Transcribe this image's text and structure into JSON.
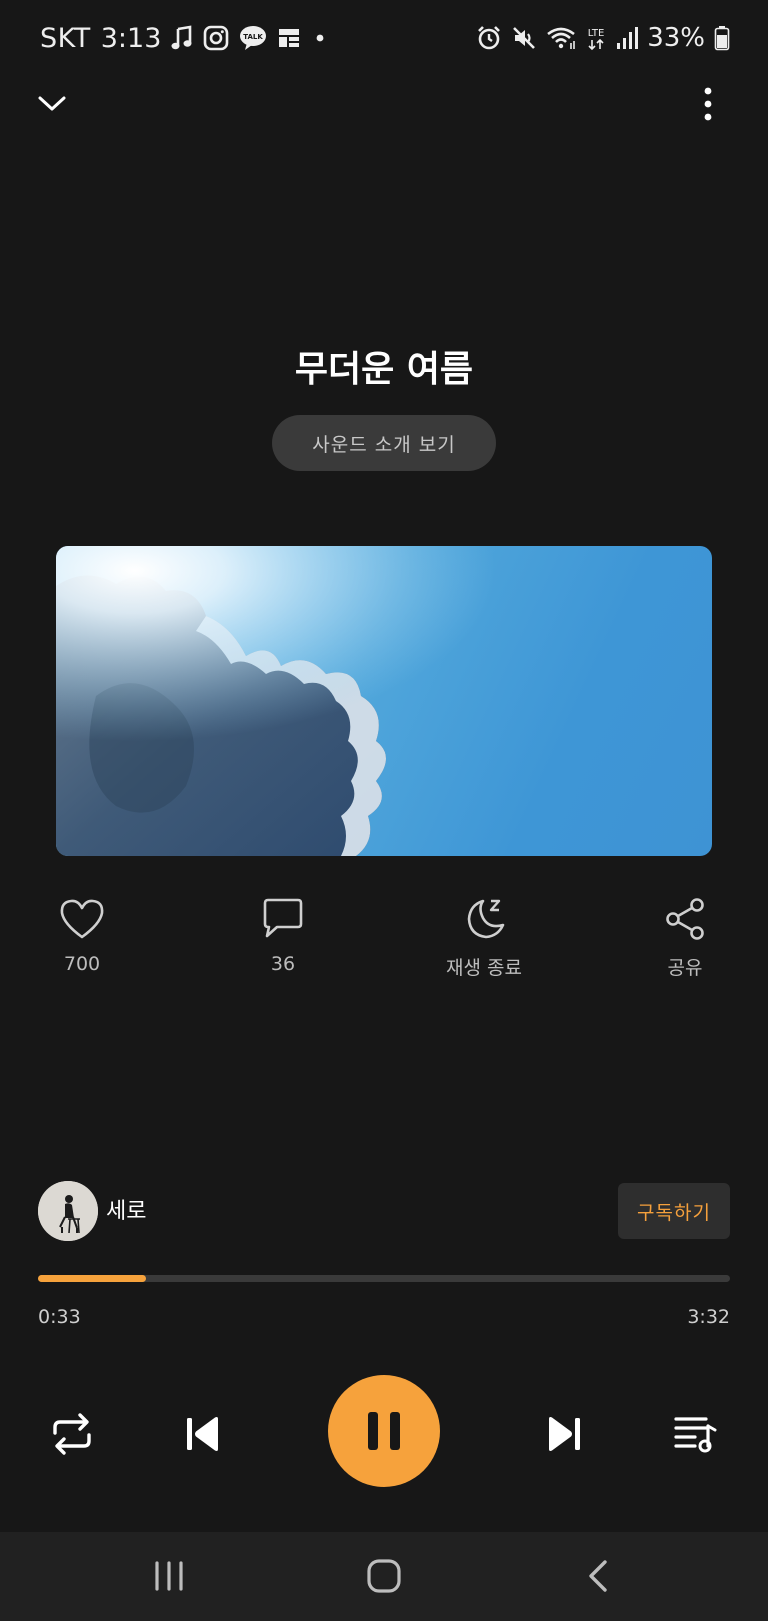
{
  "status_bar": {
    "carrier": "SKT",
    "time": "3:13",
    "battery": "33%",
    "network": "LTE",
    "icons_left": [
      "music-note-icon",
      "instagram-icon",
      "kakaotalk-icon",
      "news-icon",
      "dot-icon"
    ],
    "icons_right": [
      "alarm-icon",
      "mute-icon",
      "wifi-icon",
      "lte-icon",
      "signal-icon",
      "battery-icon"
    ]
  },
  "header": {
    "collapse_icon": "chevron-down-icon",
    "more_icon": "more-vertical-icon"
  },
  "track": {
    "title": "무더운 여름",
    "intro_button": "사운드 소개 보기",
    "cover_description": "sunlit clouds in blue sky"
  },
  "actions": {
    "like": {
      "icon": "heart-icon",
      "label": "700"
    },
    "comment": {
      "icon": "comment-icon",
      "label": "36"
    },
    "sleep_timer": {
      "icon": "moon-sleep-icon",
      "label": "재생 종료"
    },
    "share": {
      "icon": "share-icon",
      "label": "공유"
    }
  },
  "artist": {
    "name": "세로",
    "subscribe_label": "구독하기"
  },
  "playback": {
    "current_time": "0:33",
    "total_time": "3:32",
    "progress": 0.156
  },
  "controls": [
    "repeat-icon",
    "previous-icon",
    "pause-icon",
    "next-icon",
    "playlist-icon"
  ],
  "nav_bar": [
    "recent-apps-icon",
    "home-icon",
    "back-icon"
  ],
  "colors": {
    "background": "#171717",
    "accent": "#f6a23c",
    "button_bg": "#3a3a3a",
    "nav_bg": "#212121"
  }
}
